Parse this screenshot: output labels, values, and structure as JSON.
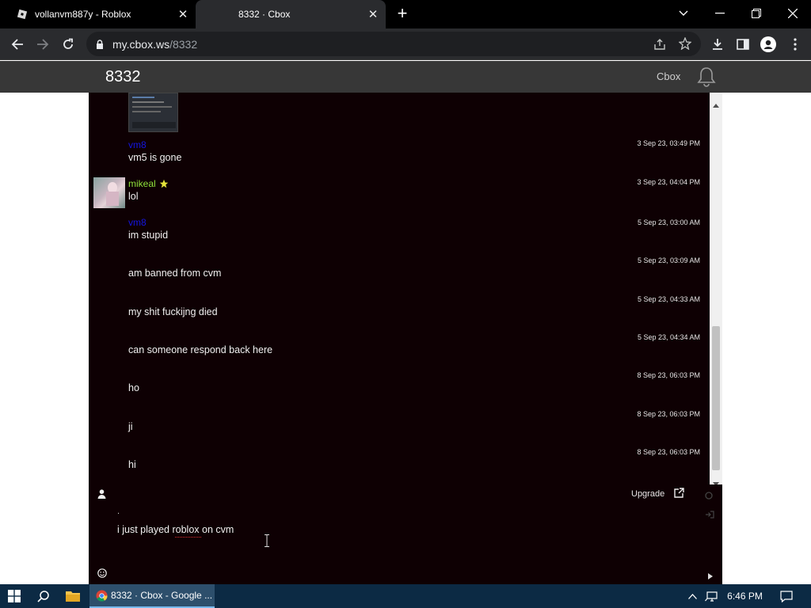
{
  "browser": {
    "tabs": [
      {
        "title": "vollanvm887y - Roblox",
        "active": false
      },
      {
        "title": "8332 · Cbox",
        "active": true
      }
    ],
    "url_host": "my.cbox.ws",
    "url_path": "/8332"
  },
  "cbox": {
    "room_title": "8332",
    "brand_link": "Cbox",
    "messages": [
      {
        "name": "vm8",
        "name_color": "#1515e0",
        "text": "vm5 is gone",
        "time": "3 Sep 23, 03:49 PM"
      },
      {
        "name": "mikeal",
        "name_color": "#8ee03a",
        "text": "lol",
        "time": "3 Sep 23, 04:04 PM",
        "has_avatar": true,
        "has_star": true
      },
      {
        "name": "vm8",
        "name_color": "#1515e0",
        "text": "im stupid",
        "time": "5 Sep 23, 03:00 AM"
      },
      {
        "name": "",
        "text": "am banned from cvm",
        "time": "5 Sep 23, 03:09 AM"
      },
      {
        "name": "",
        "text": "my shit fuckijng died",
        "time": "5 Sep 23, 04:33 AM"
      },
      {
        "name": "",
        "text": "can someone respond back here",
        "time": "5 Sep 23, 04:34 AM"
      },
      {
        "name": "",
        "text": "ho",
        "time": "8 Sep 23, 06:03 PM"
      },
      {
        "name": "",
        "text": "ji",
        "time": "8 Sep 23, 06:03 PM"
      },
      {
        "name": "",
        "text": "hi",
        "time": "8 Sep 23, 06:03 PM"
      }
    ],
    "upgrade_label": "Upgrade",
    "name_field_value": ".",
    "message_input_value": "i just played roblox on cvm"
  },
  "taskbar": {
    "active_app_label": "8332 · Cbox - Google ...",
    "clock": "6:46 PM"
  },
  "colors": {
    "chat_bg": "#0e0003",
    "header_bg": "#373737",
    "taskbar_bg": "#0c2a44"
  }
}
